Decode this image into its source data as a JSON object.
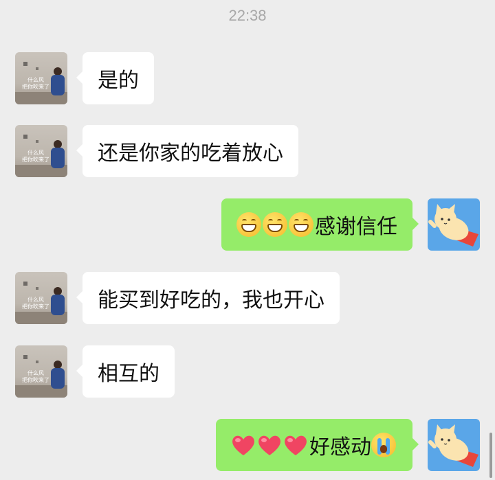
{
  "timestamp": "22:38",
  "contact": {
    "avatar_caption": "什么风\n把你吹来了",
    "avatar_icon": "child-photo-avatar"
  },
  "me": {
    "avatar_icon": "flying-cat-avatar"
  },
  "messages": [
    {
      "from": "contact",
      "text": "是的"
    },
    {
      "from": "contact",
      "text": "还是你家的吃着放心"
    },
    {
      "from": "me",
      "emoji": [
        "grin-icon",
        "grin-icon",
        "grin-icon"
      ],
      "text": "感谢信任"
    },
    {
      "from": "contact",
      "text": "能买到好吃的，我也开心"
    },
    {
      "from": "contact",
      "text": "相互的"
    },
    {
      "from": "me",
      "emoji": [
        "heart-icon",
        "heart-icon",
        "heart-icon"
      ],
      "text": "好感动",
      "trailing_emoji": "crying-icon"
    }
  ],
  "colors": {
    "background": "#ededed",
    "incoming_bubble": "#ffffff",
    "outgoing_bubble": "#95ec69",
    "timestamp": "#a8a8a8"
  }
}
